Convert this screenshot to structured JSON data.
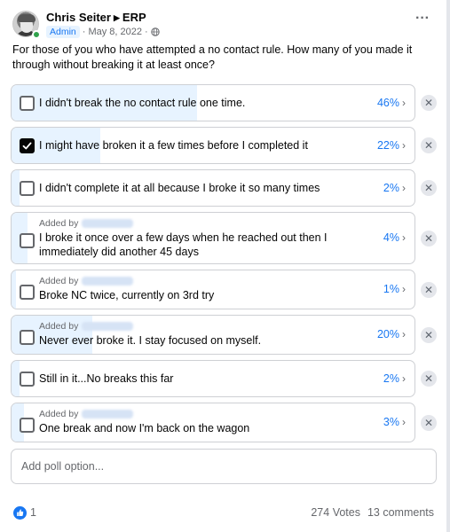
{
  "post": {
    "author": "Chris Seiter",
    "group": "ERP",
    "badge": "Admin",
    "date": "May 8, 2022",
    "dot": "·",
    "question": "For those of you who have attempted a no contact rule. How many of you made it through without breaking it at least once?"
  },
  "poll": {
    "added_by_label": "Added by",
    "options": [
      {
        "label": "I didn't break the no contact rule one time.",
        "percent": "46%",
        "value": 46,
        "checked": false,
        "added_by": false
      },
      {
        "label": "I might have broken it a few times before I completed it",
        "percent": "22%",
        "value": 22,
        "checked": true,
        "added_by": false
      },
      {
        "label": "I didn't complete it at all because I broke it so many times",
        "percent": "2%",
        "value": 2,
        "checked": false,
        "added_by": false
      },
      {
        "label": "I broke it once over a few days when he reached out then I immediately did another 45 days",
        "percent": "4%",
        "value": 4,
        "checked": false,
        "added_by": true
      },
      {
        "label": "Broke NC twice, currently on 3rd try",
        "percent": "1%",
        "value": 1,
        "checked": false,
        "added_by": true
      },
      {
        "label": "Never ever broke it. I stay focused on myself.",
        "percent": "20%",
        "value": 20,
        "checked": false,
        "added_by": true
      },
      {
        "label": "Still in it...No breaks this far",
        "percent": "2%",
        "value": 2,
        "checked": false,
        "added_by": false
      },
      {
        "label": "One break and now I'm back on the wagon",
        "percent": "3%",
        "value": 3,
        "checked": false,
        "added_by": true
      }
    ],
    "add_option_placeholder": "Add poll option..."
  },
  "footer": {
    "likes": "1",
    "votes": "274 Votes",
    "comments": "13 comments"
  },
  "colors": {
    "accent": "#1877f2",
    "fill": "#e7f3ff",
    "online": "#31a24c"
  },
  "icons": {
    "more": "ellipsis-icon",
    "remove": "close-icon",
    "like": "thumbs-up-icon",
    "privacy": "globe-icon",
    "next": "chevron-right-icon"
  }
}
